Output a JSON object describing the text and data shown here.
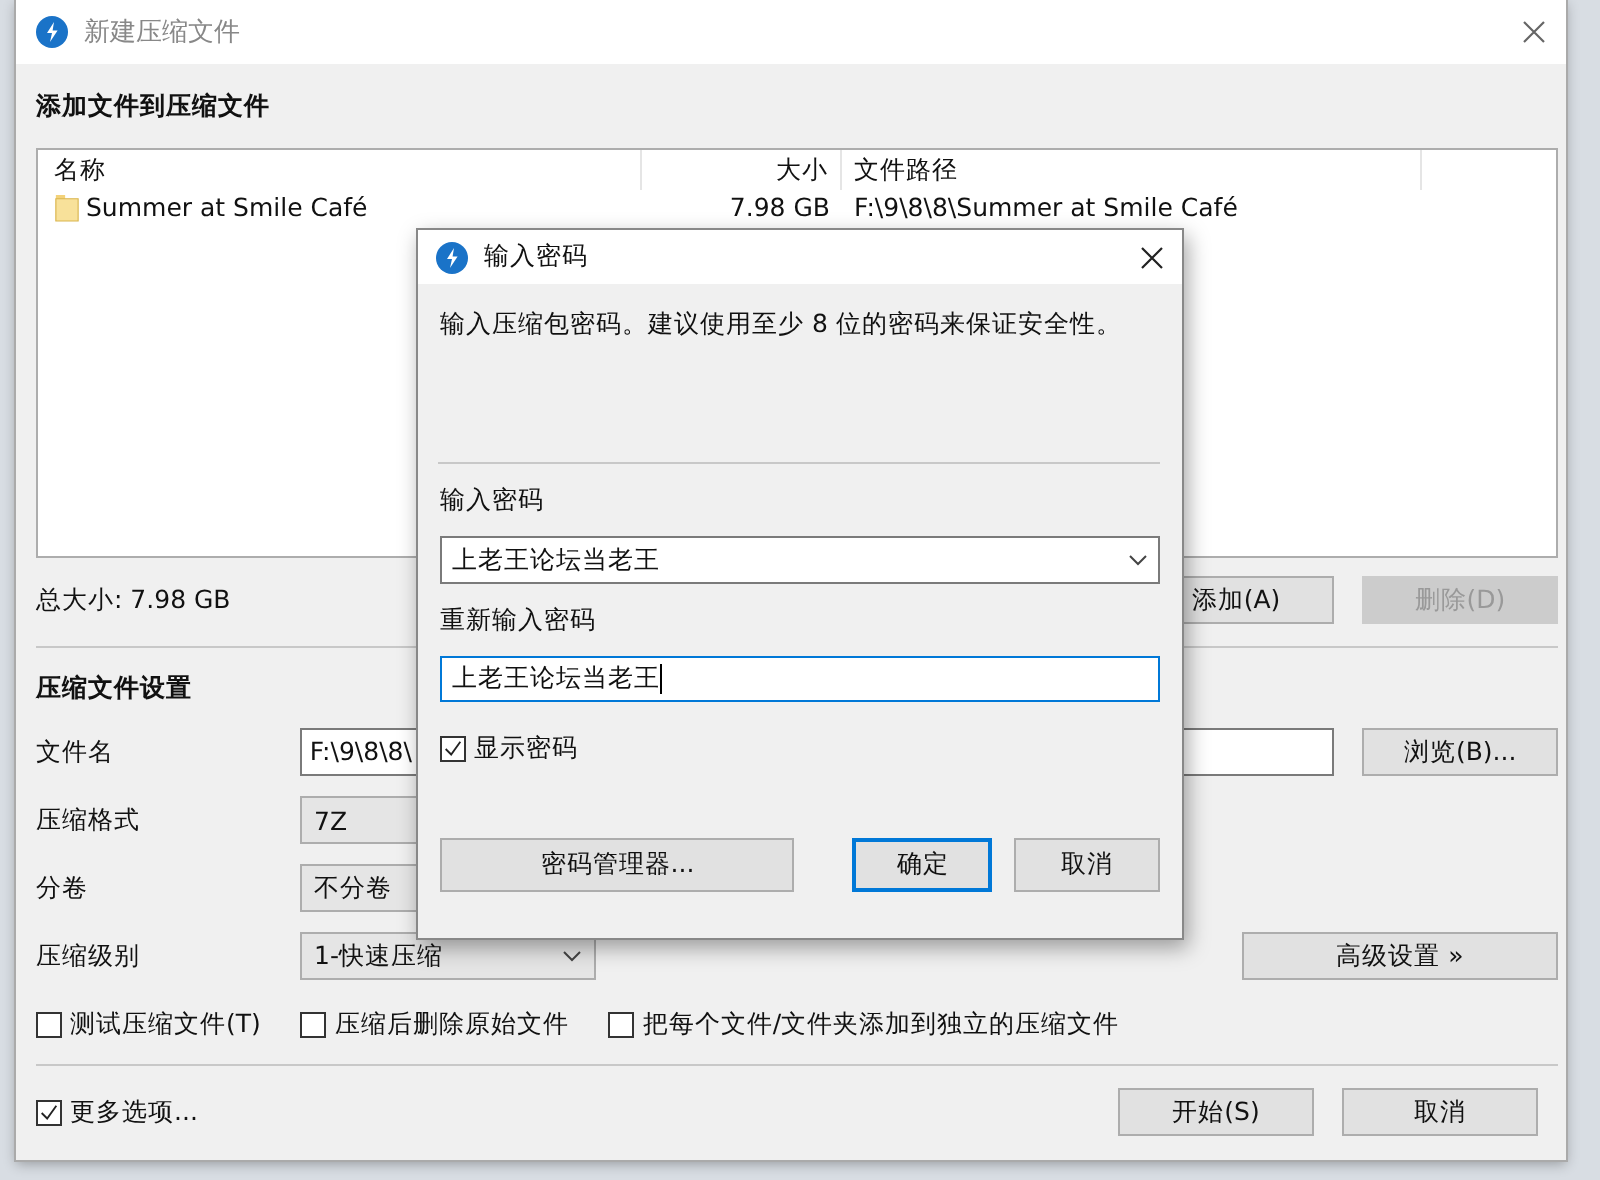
{
  "window": {
    "title": "新建压缩文件"
  },
  "files_section": {
    "heading": "添加文件到压缩文件",
    "columns": [
      "名称",
      "大小",
      "文件路径"
    ],
    "rows": [
      {
        "name": "Summer at Smile Café",
        "size": "7.98 GB",
        "path": "F:\\9\\8\\8\\Summer at Smile Café"
      }
    ],
    "total": "总大小: 7.98 GB",
    "buttons": [
      {
        "label": "添加(A)",
        "disabled": false
      },
      {
        "label": "删除(D)",
        "disabled": true
      }
    ]
  },
  "settings": {
    "heading": "压缩文件设置",
    "fields": [
      {
        "kind": "text",
        "label": "文件名",
        "value": "F:\\9\\8\\8\\",
        "button": "浏览(B)..."
      },
      {
        "kind": "select",
        "label": "压缩格式",
        "value": "7Z"
      },
      {
        "kind": "select",
        "label": "分卷",
        "value": "不分卷"
      },
      {
        "kind": "select",
        "label": "压缩级别",
        "value": "1-快速压缩",
        "caret": true,
        "button": "高级设置 »"
      }
    ],
    "options": [
      {
        "label": "测试压缩文件(T)",
        "checked": false
      },
      {
        "label": "压缩后删除原始文件",
        "checked": false
      },
      {
        "label": "把每个文件/文件夹添加到独立的压缩文件",
        "checked": false
      }
    ]
  },
  "footer": {
    "more_options": {
      "label": "更多选项...",
      "checked": true
    },
    "buttons": [
      "开始(S)",
      "取消"
    ]
  },
  "dialog": {
    "title": "输入密码",
    "message": "输入压缩包密码。建议使用至少 8 位的密码来保证安全性。",
    "password_label": "输入密码",
    "password": "上老王论坛当老王",
    "confirm_label": "重新输入密码",
    "confirm": "上老王论坛当老王",
    "show_password": {
      "label": "显示密码",
      "checked": true
    },
    "buttons": [
      {
        "label": "密码管理器...",
        "default": false
      },
      {
        "label": "确定",
        "default": true
      },
      {
        "label": "取消",
        "default": false
      }
    ]
  }
}
